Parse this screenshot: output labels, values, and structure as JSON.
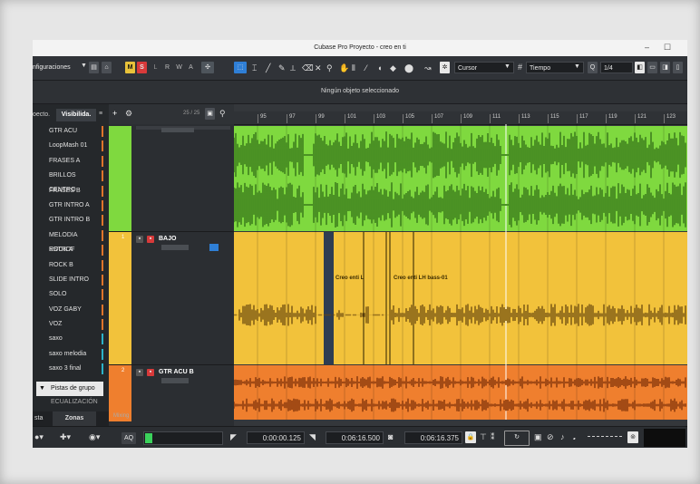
{
  "window": {
    "title": "Cubase Pro Proyecto - creo en ti",
    "minimize": "–",
    "maximize": "☐"
  },
  "toolbar": {
    "configuraciones": "nfiguraciones",
    "m_label": "M",
    "s_label": "S",
    "l_label": "L",
    "r_label": "R",
    "w_label": "W",
    "a_label": "A",
    "cursor_label": "Cursor",
    "tiempo_label": "Tiempo",
    "quantize_label": "1/4",
    "q_label": "Q"
  },
  "info_line": {
    "text": "Ningún objeto seleccionado"
  },
  "left_zone": {
    "tabs": [
      "oecto.",
      "Visibilida."
    ],
    "items": [
      {
        "label": "GTR ACU",
        "color": "#e0742b"
      },
      {
        "label": "LoopMash 01",
        "color": "#e0742b"
      },
      {
        "label": "FRASES A",
        "color": "#e0742b"
      },
      {
        "label": "BRILLOS CENTRO",
        "color": "#e0742b"
      },
      {
        "label": "FRASES B",
        "color": "#e0742b"
      },
      {
        "label": "GTR INTRO A",
        "color": "#e0742b"
      },
      {
        "label": "GTR INTRO B",
        "color": "#e0742b"
      },
      {
        "label": "MELODIA ESTROF",
        "color": "#e0742b"
      },
      {
        "label": "ROCK A",
        "color": "#e0742b"
      },
      {
        "label": "ROCK B",
        "color": "#e0742b"
      },
      {
        "label": "SLIDE INTRO",
        "color": "#e0742b"
      },
      {
        "label": "SOLO",
        "color": "#e0742b"
      },
      {
        "label": "VOZ GABY",
        "color": "#e0742b"
      },
      {
        "label": "VOZ",
        "color": "#e0742b"
      },
      {
        "label": "saxo",
        "color": "#2bb3c9"
      },
      {
        "label": "saxo melodia",
        "color": "#2bb3c9"
      },
      {
        "label": "saxo 3 final",
        "color": "#2bb3c9"
      }
    ],
    "pistas_de_grupo": "Pistas de grupo",
    "ecualizacion": "ECUALIZACIÓN",
    "bottom_tabs": [
      "sta",
      "Zonas"
    ]
  },
  "track_header": {
    "counter": "25 / 25",
    "mixing_label": "Mixing"
  },
  "tracks": [
    {
      "name": "",
      "color": "#7fd93f"
    },
    {
      "name": "BAJO",
      "color": "#f2c23b",
      "number": "1"
    },
    {
      "name": "GTR ACU B",
      "color": "#ef7f2e",
      "number": "2"
    }
  ],
  "ruler": {
    "bars": [
      "95",
      "97",
      "99",
      "101",
      "103",
      "105",
      "107",
      "109",
      "111",
      "113",
      "115",
      "117",
      "119",
      "121",
      "123"
    ]
  },
  "events": {
    "bajo_event_a": "Creo enti L",
    "bajo_event_b": "Creo enti LH bass-01"
  },
  "transport": {
    "time_1": "0:00:00.125",
    "time_2": "0:06:16.500",
    "time_3": "0:06:16.375",
    "aq": "AQ"
  }
}
